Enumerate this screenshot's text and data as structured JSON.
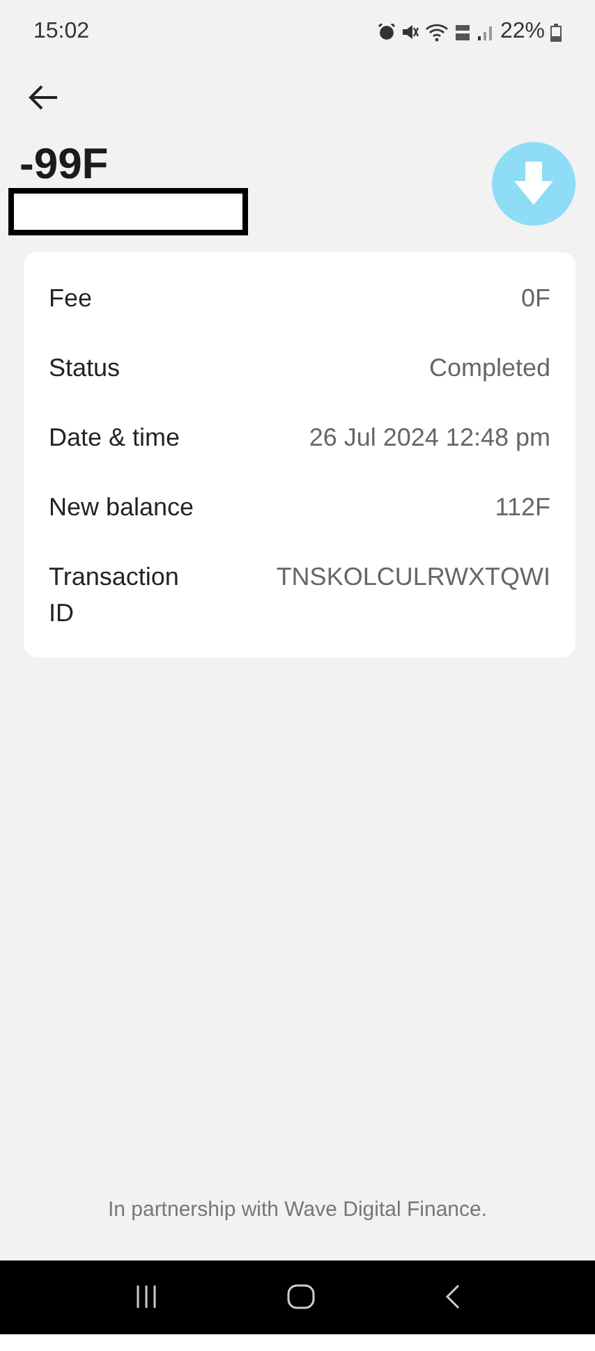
{
  "status_bar": {
    "time": "15:02",
    "battery": "22%"
  },
  "amount": "-99F",
  "details": [
    {
      "label": "Fee",
      "value": "0F"
    },
    {
      "label": "Status",
      "value": "Completed"
    },
    {
      "label": "Date & time",
      "value": "26 Jul 2024 12:48 pm"
    },
    {
      "label": "New balance",
      "value": "112F"
    },
    {
      "label": "Transaction ID",
      "value": "TNSKOLCULRWXTQWI"
    }
  ],
  "footer": "In partnership with Wave Digital Finance."
}
